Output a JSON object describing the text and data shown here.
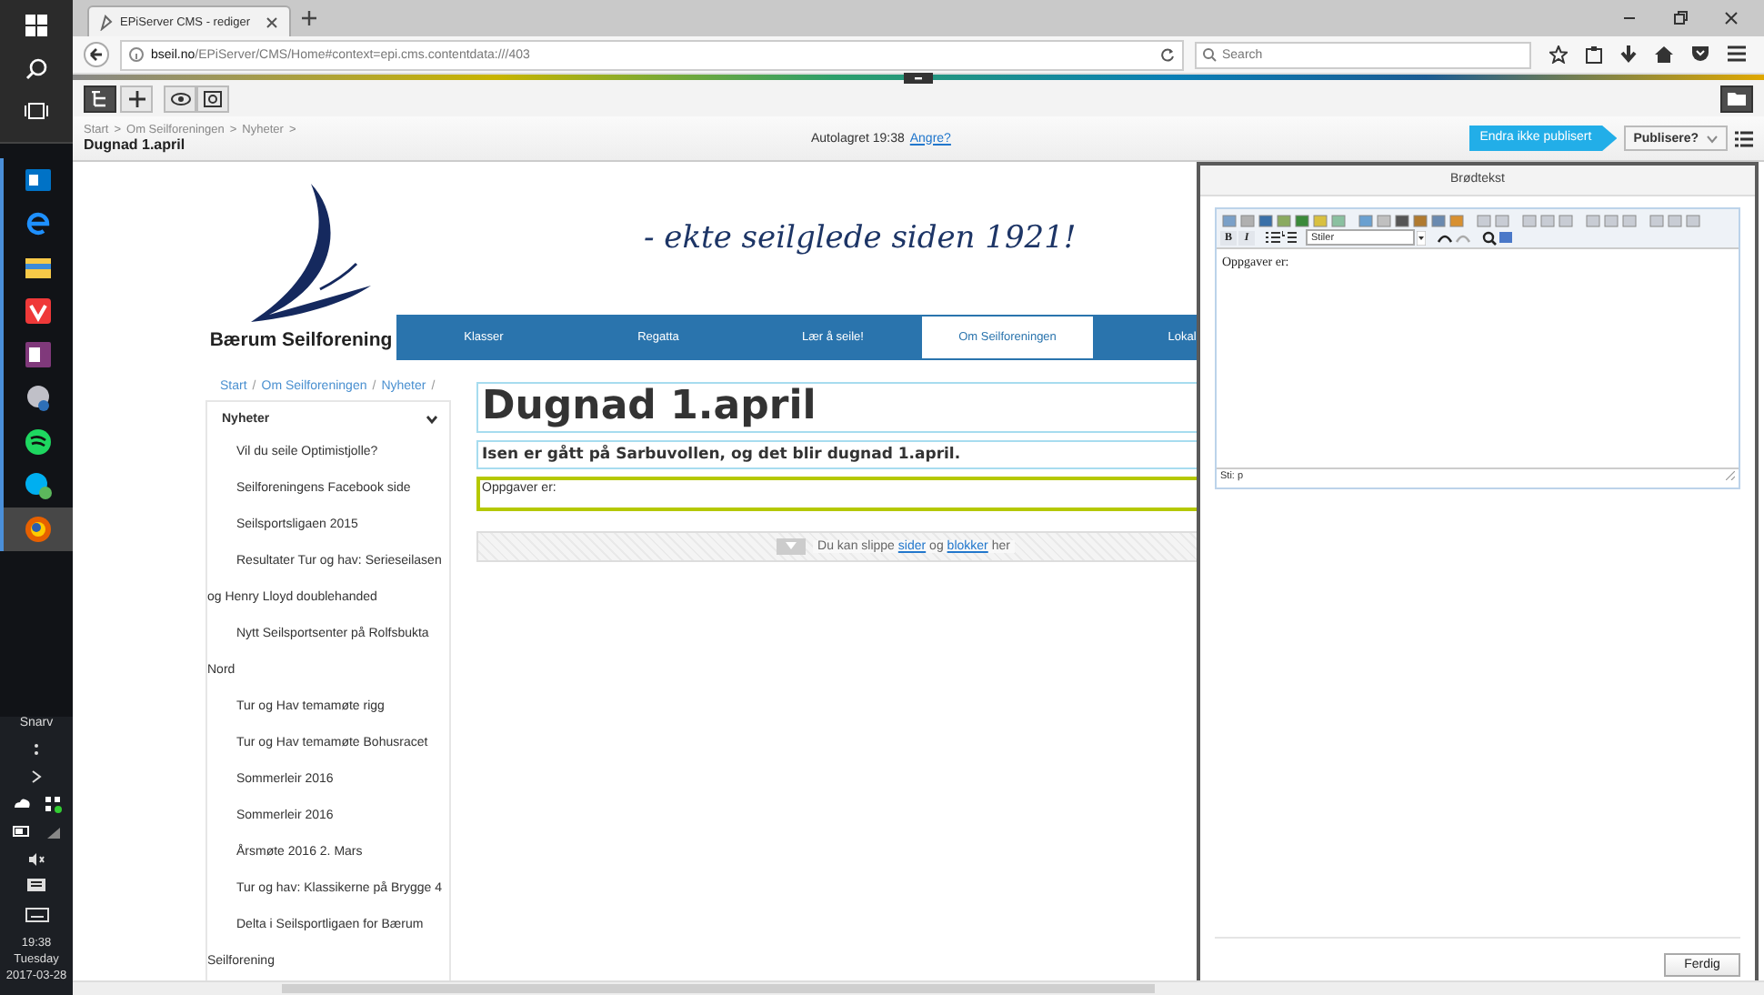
{
  "taskbar": {
    "apps": [
      {
        "kind": "outlook",
        "selected": false
      },
      {
        "kind": "edge",
        "selected": false
      },
      {
        "kind": "files",
        "selected": false
      },
      {
        "kind": "vivaldi",
        "selected": false
      },
      {
        "kind": "onenote",
        "selected": false
      },
      {
        "kind": "remote",
        "selected": false
      },
      {
        "kind": "spotify",
        "selected": false
      },
      {
        "kind": "skype",
        "selected": false
      },
      {
        "kind": "firefox",
        "selected": true
      }
    ],
    "tray_label": "Snarv",
    "time": "19:38",
    "day": "Tuesday",
    "date": "2017-03-28"
  },
  "browser": {
    "tab": {
      "title": "EPiServer CMS - rediger"
    },
    "url_host": "bseil.no",
    "url_path": "/EPiServer/CMS/Home#context=epi.cms.contentdata:///403",
    "search": {
      "placeholder": "Search"
    }
  },
  "cms": {
    "breadcrumb": {
      "separator": ">",
      "items": [
        "Start",
        "Om Seilforeningen",
        "Nyheter"
      ]
    },
    "page_title": "Dugnad 1.april",
    "autosave": "Autolagret 19:38",
    "undo_link": "Angre?",
    "status_badge": "Endra ikke publisert",
    "publish_button": "Publisere?"
  },
  "site": {
    "org_name": "Bærum Seilforening",
    "tagline": "- ekte seilglede siden 1921!",
    "nav": [
      {
        "label": "Klasser",
        "selected": false
      },
      {
        "label": "Regatta",
        "selected": false
      },
      {
        "label": "Lær å seile!",
        "selected": false
      },
      {
        "label": "Om Seilforeningen",
        "selected": true
      },
      {
        "label": "Lokal",
        "selected": false
      }
    ],
    "breadcrumb": {
      "separator": "/",
      "items": [
        "Start",
        "Om Seilforeningen",
        "Nyheter"
      ]
    },
    "sidebar": {
      "heading": "Nyheter",
      "expanded": true,
      "items": [
        "Vil du seile Optimistjolle?",
        "Seilforeningens Facebook side",
        "Seilsportsligaen 2015",
        "Resultater Tur og hav: Serieseilasen og Henry Lloyd doublehanded",
        "Nytt Seilsportsenter på Rolfsbukta Nord",
        "Tur og Hav temamøte rigg",
        "Tur og Hav temamøte Bohusracet",
        "Sommerleir 2016",
        "Sommerleir 2016",
        "Årsmøte 2016 2. Mars",
        "Tur og hav: Klassikerne på Brygge 4",
        "Delta i Seilsportligaen for Bærum Seilforening"
      ]
    },
    "heading": "Dugnad 1.april",
    "intro": "Isen er gått på Sarbuvollen, og det blir dugnad 1.april.",
    "body_field": "Oppgaver er:",
    "dropzone": [
      {
        "kind": "text",
        "text": "Du kan slippe"
      },
      {
        "kind": "link",
        "text": "sider"
      },
      {
        "kind": "text",
        "text": "og"
      },
      {
        "kind": "link",
        "text": "blokker"
      },
      {
        "kind": "text",
        "text": "her"
      }
    ]
  },
  "editor_dialog": {
    "title": "Brødtekst",
    "bold_button": "B",
    "italic_button": "I",
    "style_select": "Stiler",
    "content": "Oppgaver er:",
    "path": "Sti: p",
    "done_button": "Ferdig"
  }
}
